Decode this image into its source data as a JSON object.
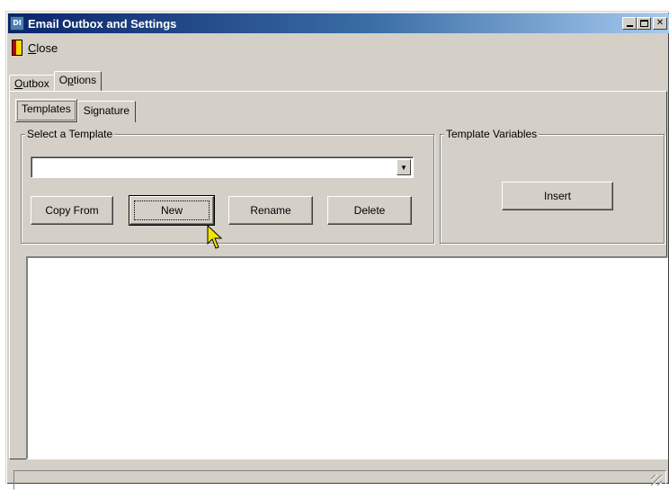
{
  "window": {
    "title": "Email Outbox and Settings",
    "app_icon_text": "DI",
    "caption_buttons": [
      "minimize",
      "maximize",
      "close"
    ]
  },
  "toolbar": {
    "close_label_accel": "C",
    "close_label_rest": "lose"
  },
  "tabs": [
    {
      "accel": "O",
      "rest": "utbox",
      "active": false
    },
    {
      "pre": "O",
      "accel": "p",
      "rest": "tions",
      "active": true
    }
  ],
  "subtabs": [
    {
      "label": "Templates",
      "active": true
    },
    {
      "label": "Signature",
      "active": false
    }
  ],
  "template_group": {
    "legend": "Select a Template",
    "selected_value": "",
    "buttons": {
      "copy_from": "Copy From",
      "new": "New",
      "rename": "Rename",
      "delete": "Delete"
    }
  },
  "variables_group": {
    "legend": "Template Variables",
    "insert_label": "Insert"
  },
  "editor": {
    "content": ""
  },
  "status_bar": {
    "text": ""
  }
}
